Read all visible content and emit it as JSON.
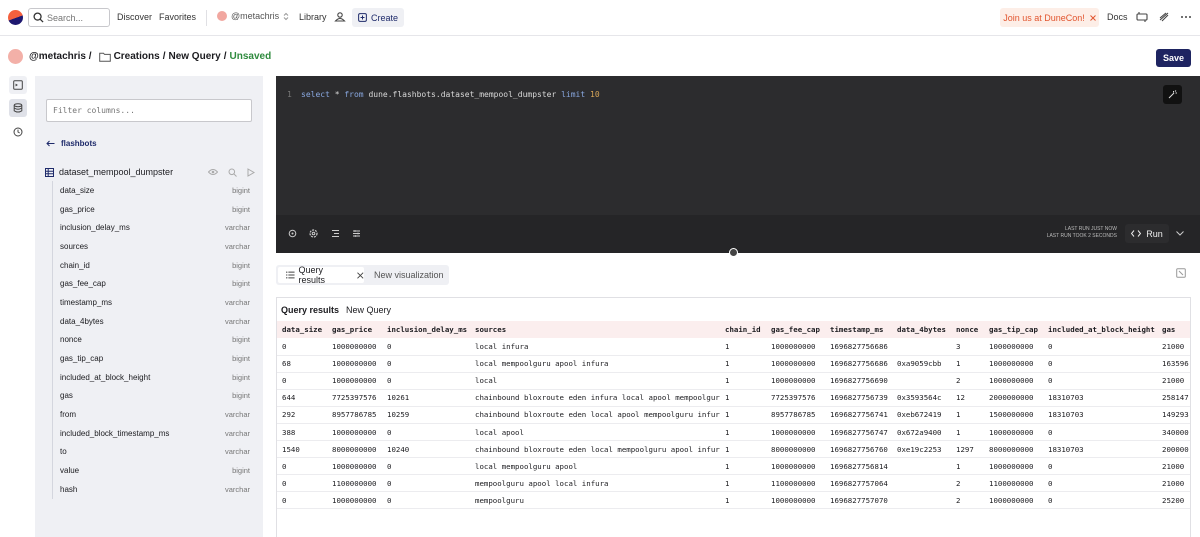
{
  "nav": {
    "search_placeholder": "Search...",
    "discover": "Discover",
    "favorites": "Favorites",
    "user": "@metachris",
    "library": "Library",
    "create": "Create",
    "banner": "Join us at DuneCon!",
    "docs": "Docs"
  },
  "header": {
    "owner": "@metachris /",
    "folder": "Creations",
    "sep1": "/",
    "query_name": "New Query",
    "sep2": "/",
    "status": "Unsaved",
    "save": "Save"
  },
  "schema": {
    "filter_placeholder": "Filter columns...",
    "back_label": "flashbots",
    "table_name": "dataset_mempool_dumpster",
    "columns": [
      {
        "name": "data_size",
        "type": "bigint"
      },
      {
        "name": "gas_price",
        "type": "bigint"
      },
      {
        "name": "inclusion_delay_ms",
        "type": "varchar"
      },
      {
        "name": "sources",
        "type": "varchar"
      },
      {
        "name": "chain_id",
        "type": "bigint"
      },
      {
        "name": "gas_fee_cap",
        "type": "bigint"
      },
      {
        "name": "timestamp_ms",
        "type": "varchar"
      },
      {
        "name": "data_4bytes",
        "type": "varchar"
      },
      {
        "name": "nonce",
        "type": "bigint"
      },
      {
        "name": "gas_tip_cap",
        "type": "bigint"
      },
      {
        "name": "included_at_block_height",
        "type": "bigint"
      },
      {
        "name": "gas",
        "type": "bigint"
      },
      {
        "name": "from",
        "type": "varchar"
      },
      {
        "name": "included_block_timestamp_ms",
        "type": "varchar"
      },
      {
        "name": "to",
        "type": "varchar"
      },
      {
        "name": "value",
        "type": "bigint"
      },
      {
        "name": "hash",
        "type": "varchar"
      }
    ]
  },
  "editor": {
    "line_number": "1",
    "kw_select": "select",
    "star": " * ",
    "kw_from": "from",
    "table": " dune.flashbots.dataset_mempool_dumpster ",
    "kw_limit": "limit",
    "limit_value": " 10",
    "last_run_line1": "LAST RUN JUST NOW",
    "last_run_line2": "LAST RUN TOOK 2 SECONDS",
    "run": "Run"
  },
  "results": {
    "tab_results": "Query results",
    "tab_newviz": "New visualization",
    "title": "Query results",
    "subtitle": "New Query",
    "headers": [
      "data_size",
      "gas_price",
      "inclusion_delay_ms",
      "sources",
      "chain_id",
      "gas_fee_cap",
      "timestamp_ms",
      "data_4bytes",
      "nonce",
      "gas_tip_cap",
      "included_at_block_height",
      "gas"
    ],
    "rows": [
      [
        "0",
        "1000000000",
        "0",
        "local infura",
        "1",
        "1000000000",
        "1696827756686",
        "",
        "3",
        "1000000000",
        "0",
        "21000"
      ],
      [
        "68",
        "1000000000",
        "0",
        "local mempoolguru apool infura",
        "1",
        "1000000000",
        "1696827756686",
        "0xa9059cbb",
        "1",
        "1000000000",
        "0",
        "163596"
      ],
      [
        "0",
        "1000000000",
        "0",
        "local",
        "1",
        "1000000000",
        "1696827756690",
        "",
        "2",
        "1000000000",
        "0",
        "21000"
      ],
      [
        "644",
        "7725397576",
        "10261",
        "chainbound bloxroute eden infura local apool mempoolguru",
        "1",
        "7725397576",
        "1696827756739",
        "0x3593564c",
        "12",
        "2000000000",
        "18310703",
        "258147"
      ],
      [
        "292",
        "8957786785",
        "10259",
        "chainbound bloxroute eden local apool mempoolguru infura",
        "1",
        "8957786785",
        "1696827756741",
        "0xeb672419",
        "1",
        "1500000000",
        "18310703",
        "149293"
      ],
      [
        "388",
        "1000000000",
        "0",
        "local apool",
        "1",
        "1000000000",
        "1696827756747",
        "0x672a9400",
        "1",
        "1000000000",
        "0",
        "340000"
      ],
      [
        "1540",
        "8000000000",
        "10240",
        "chainbound bloxroute eden local mempoolguru apool infura",
        "1",
        "8000000000",
        "1696827756760",
        "0xe19c2253",
        "1297",
        "8000000000",
        "18310703",
        "200000"
      ],
      [
        "0",
        "1000000000",
        "0",
        "local mempoolguru apool",
        "1",
        "1000000000",
        "1696827756814",
        "",
        "1",
        "1000000000",
        "0",
        "21000"
      ],
      [
        "0",
        "1100000000",
        "0",
        "mempoolguru apool local infura",
        "1",
        "1100000000",
        "1696827757064",
        "",
        "2",
        "1100000000",
        "0",
        "21000"
      ],
      [
        "0",
        "1000000000",
        "0",
        "mempoolguru",
        "1",
        "1000000000",
        "1696827757070",
        "",
        "2",
        "1000000000",
        "0",
        "25200"
      ]
    ]
  },
  "colors": {
    "brand_navy": "#1e2461",
    "brand_orange": "#f4603e",
    "unsaved_green": "#2e8a3d",
    "editor_bg": "#2c2c2e",
    "header_row_bg": "#fbeeee"
  }
}
